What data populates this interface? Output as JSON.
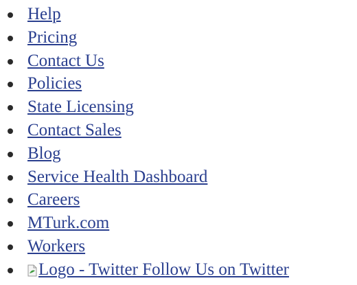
{
  "links": [
    {
      "label": "Help"
    },
    {
      "label": "Pricing"
    },
    {
      "label": "Contact Us"
    },
    {
      "label": "Policies"
    },
    {
      "label": "State Licensing"
    },
    {
      "label": "Contact Sales"
    },
    {
      "label": "Blog"
    },
    {
      "label": "Service Health Dashboard"
    },
    {
      "label": "Careers"
    },
    {
      "label": "MTurk.com"
    },
    {
      "label": "Workers"
    },
    {
      "label": "Logo - Twitter Follow Us on Twitter",
      "icon": "broken-image-icon"
    }
  ],
  "colors": {
    "link": "#2a3f8f",
    "bullet": "#2a2a2a",
    "background": "#ffffff"
  }
}
